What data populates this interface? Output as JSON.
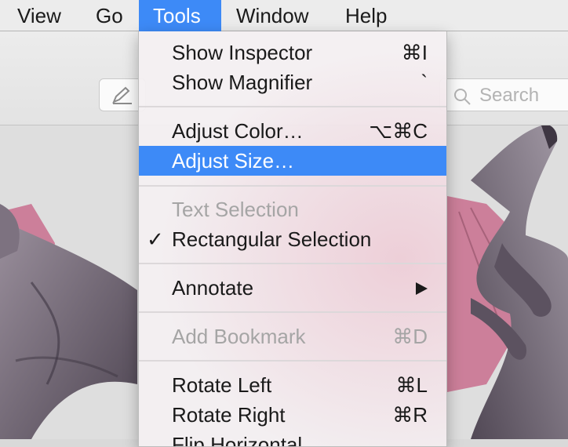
{
  "menubar": {
    "items": [
      {
        "label": "View"
      },
      {
        "label": "Go"
      },
      {
        "label": "Tools"
      },
      {
        "label": "Window"
      },
      {
        "label": "Help"
      }
    ]
  },
  "toolbar": {
    "search_placeholder": "Search"
  },
  "menu": {
    "show_inspector": {
      "label": "Show Inspector",
      "shortcut": "⌘I"
    },
    "show_magnifier": {
      "label": "Show Magnifier",
      "shortcut": "`"
    },
    "adjust_color": {
      "label": "Adjust Color…",
      "shortcut": "⌥⌘C"
    },
    "adjust_size": {
      "label": "Adjust Size…"
    },
    "text_selection": {
      "label": "Text Selection"
    },
    "rectangular_selection": {
      "label": "Rectangular Selection",
      "check": "✓"
    },
    "annotate": {
      "label": "Annotate"
    },
    "add_bookmark": {
      "label": "Add Bookmark",
      "shortcut": "⌘D"
    },
    "rotate_left": {
      "label": "Rotate Left",
      "shortcut": "⌘L"
    },
    "rotate_right": {
      "label": "Rotate Right",
      "shortcut": "⌘R"
    },
    "flip_horizontal": {
      "label": "Flip Horizontal"
    }
  },
  "colors": {
    "highlight": "#3d8af7",
    "creature_skin": "#6f6574",
    "creature_wing": "#c96e8e"
  }
}
